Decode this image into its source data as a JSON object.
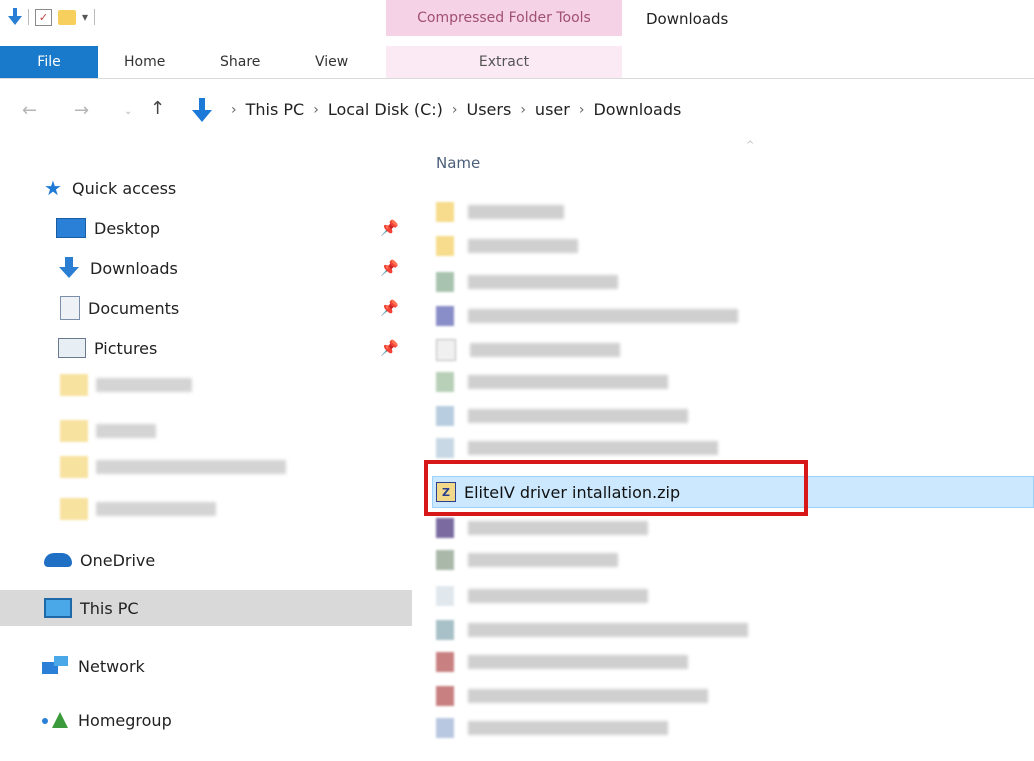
{
  "ribbon": {
    "context_header": "Compressed Folder Tools",
    "window_title": "Downloads",
    "tabs": {
      "file": "File",
      "home": "Home",
      "share": "Share",
      "view": "View",
      "extract": "Extract"
    }
  },
  "address_bar": {
    "path": [
      "This PC",
      "Local Disk (C:)",
      "Users",
      "user",
      "Downloads"
    ]
  },
  "sidebar": {
    "quick_access": "Quick access",
    "pinned": [
      {
        "label": "Desktop",
        "icon": "desktop-icon"
      },
      {
        "label": "Downloads",
        "icon": "downloads-icon"
      },
      {
        "label": "Documents",
        "icon": "documents-icon"
      },
      {
        "label": "Pictures",
        "icon": "pictures-icon"
      }
    ],
    "onedrive": "OneDrive",
    "this_pc": "This PC",
    "network": "Network",
    "homegroup": "Homegroup"
  },
  "file_list": {
    "column_name": "Name",
    "highlighted_file": "EliteIV driver intallation.zip",
    "highlight_color": "#d81818",
    "selection_color": "#cce8ff"
  },
  "colors": {
    "accent": "#1979ca",
    "context_tab": "#f6d2e6"
  }
}
